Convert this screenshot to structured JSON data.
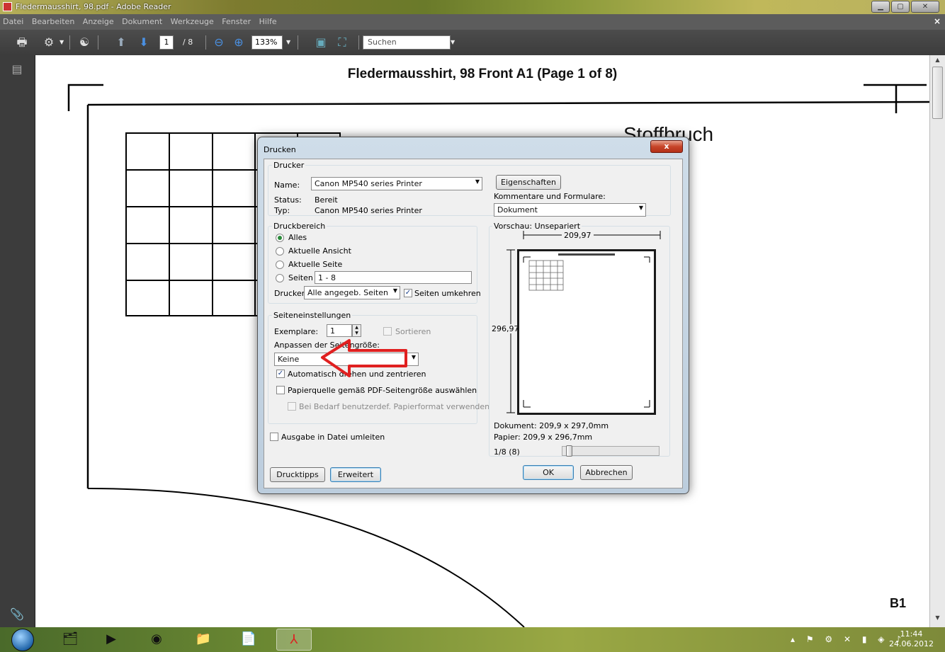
{
  "window": {
    "title": "Fledermausshirt, 98.pdf - Adobe Reader"
  },
  "menubar": {
    "items": [
      "Datei",
      "Bearbeiten",
      "Anzeige",
      "Dokument",
      "Werkzeuge",
      "Fenster",
      "Hilfe"
    ],
    "close_glyph": "×"
  },
  "toolbar": {
    "page_current": "1",
    "page_total": "/ 8",
    "zoom": "133%",
    "search_placeholder": "Suchen"
  },
  "page": {
    "header": "Fledermausshirt, 98   Front   A1   (Page 1 of 8)",
    "fold_label": "Stoffbruch",
    "corner_label": "B1"
  },
  "dialog": {
    "title": "Drucken",
    "close_glyph": "x",
    "printer": {
      "group": "Drucker",
      "name_label": "Name:",
      "name_value": "Canon MP540 series Printer",
      "status_label": "Status:",
      "status_value": "Bereit",
      "type_label": "Typ:",
      "type_value": "Canon MP540 series Printer",
      "properties_button": "Eigenschaften",
      "comments_label": "Kommentare und Formulare:",
      "comments_value": "Dokument"
    },
    "range": {
      "group": "Druckbereich",
      "all": "Alles",
      "current_view": "Aktuelle Ansicht",
      "current_page": "Aktuelle Seite",
      "pages": "Seiten",
      "pages_value": "1 - 8",
      "print_label": "Drucken:",
      "print_value": "Alle angegeb. Seiten",
      "reverse_label": "Seiten umkehren"
    },
    "page_setup": {
      "group": "Seiteneinstellungen",
      "copies_label": "Exemplare:",
      "copies_value": "1",
      "collate_label": "Sortieren",
      "scaling_label": "Anpassen der Seitengröße:",
      "scaling_value": "Keine",
      "auto_rotate_label": "Automatisch drehen und zentrieren",
      "paper_source_label": "Papierquelle gemäß PDF-Seitengröße auswählen",
      "custom_paper_label": "Bei Bedarf benutzerdef. Papierformat verwenden"
    },
    "output_to_file_label": "Ausgabe in Datei umleiten",
    "preview": {
      "label": "Vorschau: Unsepariert",
      "width_dim": "209,97",
      "height_dim": "296,97",
      "document_size": "Dokument: 209,9 x 297,0mm",
      "paper_size": "Papier: 209,9 x 296,7mm",
      "page_counter": "1/8 (8)",
      "page_fraction": 0.0
    },
    "buttons": {
      "tips": "Drucktipps",
      "advanced": "Erweitert",
      "ok": "OK",
      "cancel": "Abbrechen"
    }
  },
  "taskbar": {
    "time": "11:44",
    "date": "24.06.2012"
  },
  "colors": {
    "annotation_arrow": "#e02020",
    "radio_selected": "#2a8a3a"
  }
}
